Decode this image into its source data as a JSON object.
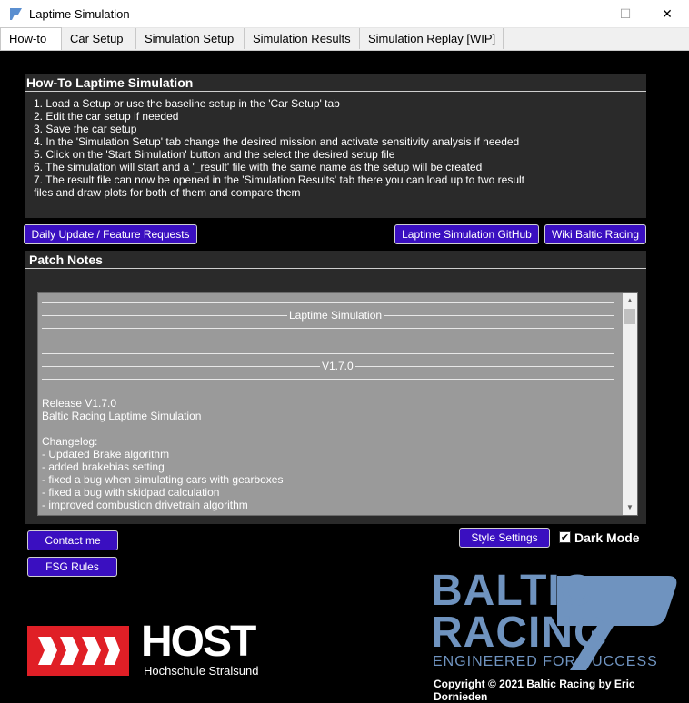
{
  "window": {
    "title": "Laptime Simulation",
    "minimize": "—",
    "maximize": "☐",
    "close": "✕"
  },
  "tabs": [
    {
      "label": "How-to",
      "active": true
    },
    {
      "label": "Car Setup",
      "active": false
    },
    {
      "label": "Simulation Setup",
      "active": false
    },
    {
      "label": "Simulation Results",
      "active": false
    },
    {
      "label": "Simulation Replay [WIP]",
      "active": false
    }
  ],
  "howto": {
    "heading": "How-To Laptime Simulation",
    "lines": [
      "1. Load a Setup or use the baseline setup in the 'Car Setup' tab",
      "2. Edit the car setup if needed",
      "3. Save the car setup",
      "4. In the 'Simulation Setup' tab change the desired mission and activate sensitivity analysis if needed",
      "5. Click on the 'Start Simulation' button and the select the desired setup file",
      "6. The simulation will start and a '_result' file with the same name as the setup will be created",
      "7. The result file can now be opened in the 'Simulation Results' tab there you can load up to two result",
      "files and draw plots for both of them and compare them"
    ]
  },
  "buttons": {
    "daily_update": "Daily Update / Feature Requests",
    "github": "Laptime Simulation GitHub",
    "wiki": "Wiki Baltic Racing",
    "contact": "Contact me",
    "fsg_rules": "FSG Rules",
    "style_settings": "Style Settings"
  },
  "patch_notes": {
    "heading": "Patch Notes",
    "banner_title": "Laptime Simulation",
    "banner_version": "V1.7.0",
    "lines": [
      "Release V1.7.0",
      "Baltic Racing Laptime Simulation",
      "",
      "Changelog:",
      "- Updated Brake algorithm",
      "- added brakebias setting",
      "- fixed a bug when simulating cars with gearboxes",
      "- fixed a bug with skidpad calculation",
      "- improved combustion drivetrain algorithm"
    ]
  },
  "dark_mode": {
    "label": "Dark Mode",
    "checked": true,
    "check_glyph": "✔"
  },
  "host_logo": {
    "name": "HOST",
    "subtitle": "Hochschule Stralsund"
  },
  "baltic_logo": {
    "line1": "BALTIC",
    "line2": "RACING",
    "tagline": "ENGINEERED FOR SUCCESS"
  },
  "copyright": "Copyright © 2021 Baltic Racing by Eric Dornieden",
  "colors": {
    "accent": "#3a0fc0",
    "frame": "#2a2a2a",
    "brand_blue": "#6f93bf",
    "host_red": "#e01f26"
  },
  "scroll_arrows": {
    "up": "▲",
    "down": "▼"
  }
}
